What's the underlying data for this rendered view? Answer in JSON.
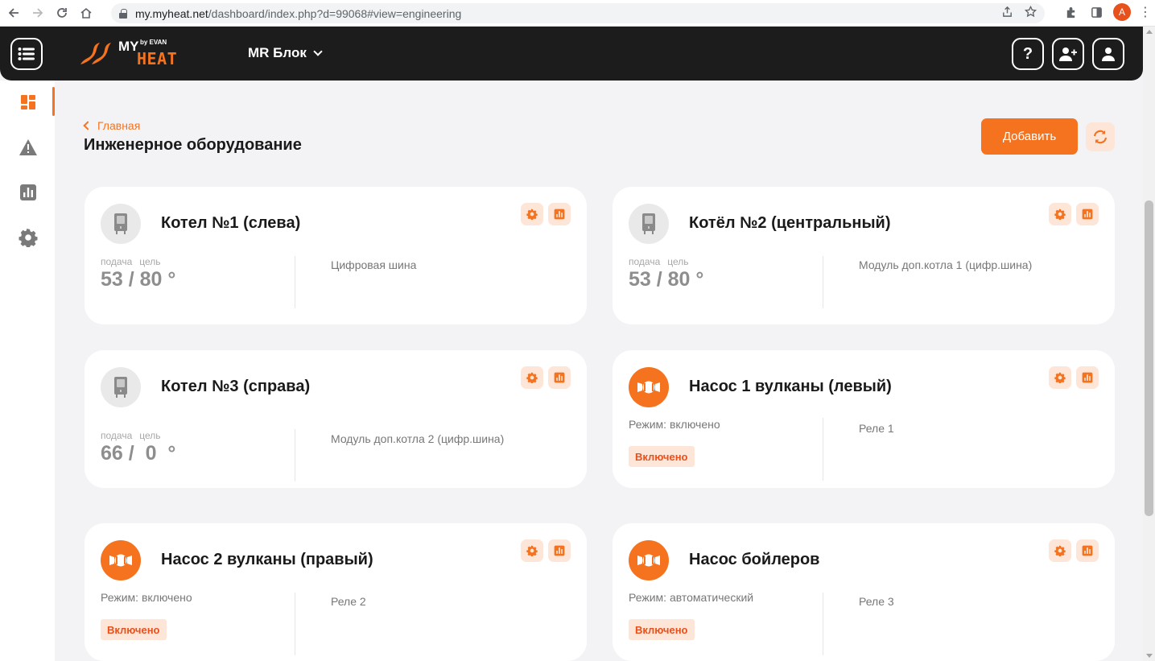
{
  "browser": {
    "url_host": "my.myheat.net",
    "url_path": "/dashboard/index.php?d=99068#view=engineering",
    "profile_initial": "A"
  },
  "header": {
    "building_name": "MR Блок",
    "help_label": "?"
  },
  "page": {
    "breadcrumb": "Главная",
    "title": "Инженерное оборудование",
    "add_button": "Добавить"
  },
  "cards": [
    {
      "kind": "boiler",
      "title": "Котел №1 (слева)",
      "supply_label": "подача",
      "target_label": "цель",
      "temperature": "53 / 80 °",
      "source": "Цифровая шина"
    },
    {
      "kind": "boiler",
      "title": "Котёл №2 (центральный)",
      "supply_label": "подача",
      "target_label": "цель",
      "temperature": "53 / 80 °",
      "source": "Модуль доп.котла 1 (цифр.шина)"
    },
    {
      "kind": "boiler",
      "title": "Котел №3 (справа)",
      "supply_label": "подача",
      "target_label": "цель",
      "temperature": "66 /  0  °",
      "source": "Модуль доп.котла 2 (цифр.шина)"
    },
    {
      "kind": "pump",
      "title": "Насос 1 вулканы (левый)",
      "mode": "Режим: включено",
      "status": "Включено",
      "source": "Реле 1"
    },
    {
      "kind": "pump",
      "title": "Насос 2 вулканы (правый)",
      "mode": "Режим: включено",
      "status": "Включено",
      "source": "Реле 2"
    },
    {
      "kind": "pump",
      "title": "Насос бойлеров",
      "mode": "Режим: автоматический",
      "status": "Включено",
      "source": "Реле 3"
    }
  ],
  "colors": {
    "accent": "#f5731e",
    "accent_light": "#fde6d8",
    "header_bg": "#1c1c1c",
    "page_bg": "#f3f3f5"
  },
  "icons": {
    "sidebar": [
      "dashboard-icon",
      "alert-icon",
      "chart-icon",
      "gear-icon"
    ],
    "card_actions": [
      "gear-icon",
      "chart-icon"
    ],
    "boiler": "boiler-icon",
    "pump": "pump-icon"
  }
}
